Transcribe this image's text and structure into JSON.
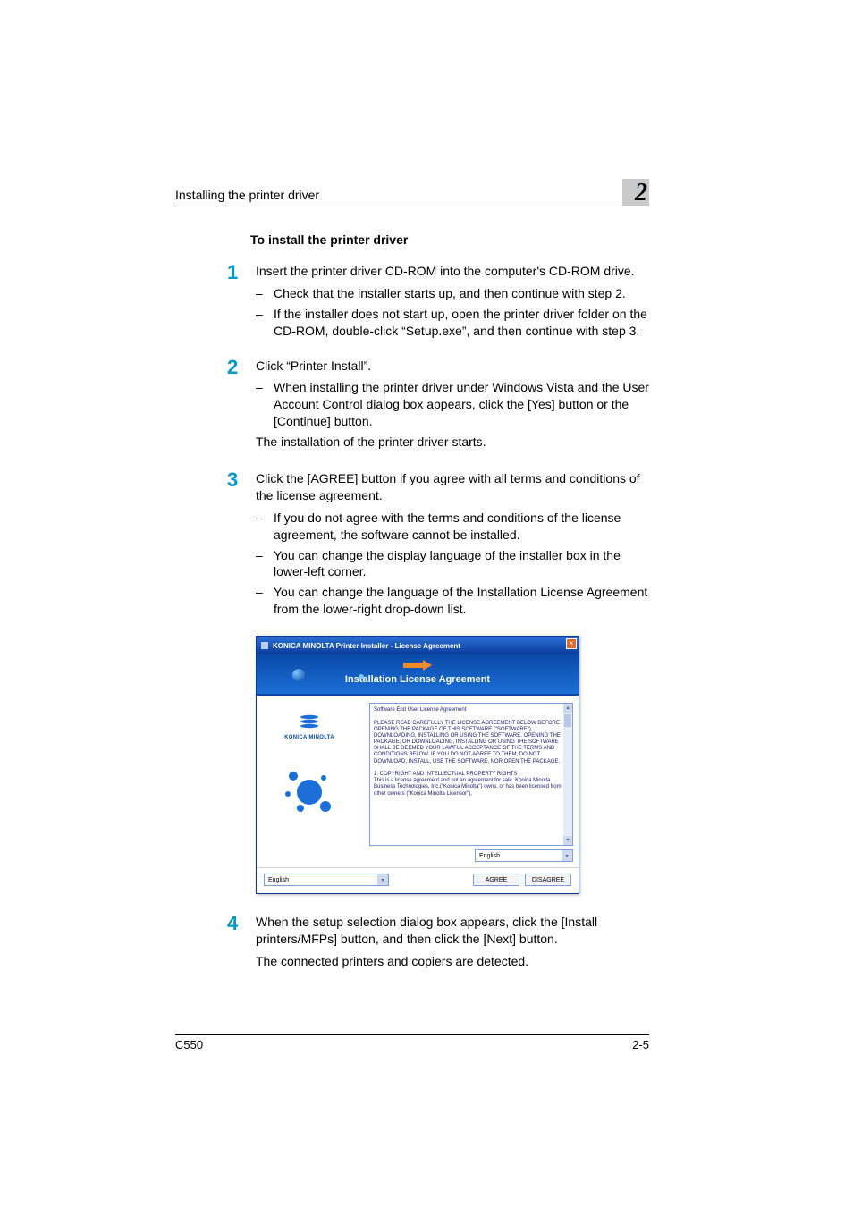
{
  "header": {
    "section_title": "Installing the printer driver",
    "chapter_number": "2"
  },
  "section_heading": "To install the printer driver",
  "steps": [
    {
      "num": "1",
      "text": "Insert the printer driver CD-ROM into the computer's CD-ROM drive.",
      "subs": [
        "Check that the installer starts up, and then continue with step 2.",
        "If the installer does not start up, open the printer driver folder on the CD-ROM, double-click “Setup.exe”, and then continue with step 3."
      ]
    },
    {
      "num": "2",
      "text": "Click “Printer Install”.",
      "subs": [
        "When installing the printer driver under Windows Vista and the User Account Control dialog box appears, click the [Yes] button or the [Continue] button."
      ],
      "after": "The installation of the printer driver starts."
    },
    {
      "num": "3",
      "text": "Click the [AGREE] button if you agree with all terms and conditions of the license agreement.",
      "subs": [
        "If you do not agree with the terms and conditions of the license agreement, the software cannot be installed.",
        "You can change the display language of the installer box in the lower-left corner.",
        "You can change the language of the Installation License Agreement from the lower-right drop-down list."
      ]
    },
    {
      "num": "4",
      "text": "When the setup selection dialog box appears, click the [Install printers/MFPs] button, and then click the [Next] button.",
      "after": "The connected printers and copiers are detected."
    }
  ],
  "dialog": {
    "titlebar": "KONICA MINOLTA Printer Installer - License Agreement",
    "banner_title": "Installation License Agreement",
    "logo_text": "KONICA MINOLTA",
    "license_heading": "Software End User License Agreement",
    "license_body_1": "PLEASE READ CAREFULLY THE LICENSE AGREEMENT BELOW BEFORE OPENING THE PACKAGE OF THIS SOFTWARE (\"SOFTWARE\"), DOWNLOADING, INSTALLING OR USING THE SOFTWARE. OPENING THE PACKAGE, OR DOWNLOADING, INSTALLING OR USING THE SOFTWARE SHALL BE DEEMED YOUR LAWFUL ACCEPTANCE OF THE TERMS AND CONDITIONS BELOW. IF YOU DO NOT AGREE TO THEM, DO NOT DOWNLOAD, INSTALL, USE THE SOFTWARE, NOR OPEN THE PACKAGE.",
    "license_body_2": "1. COPYRIGHT AND INTELLECTUAL PROPERTY RIGHTS\nThis is a license agreement and not an agreement for sale. Konica Minolta Business Technologies, Inc.(\"Konica Minolta\") owns, or has been licensed from other owners (\"Konica Minolta Licensor\"),",
    "lang_right": "English",
    "lang_left": "English",
    "btn_agree": "AGREE",
    "btn_disagree": "DISAGREE"
  },
  "footer": {
    "model": "C550",
    "page": "2-5"
  }
}
